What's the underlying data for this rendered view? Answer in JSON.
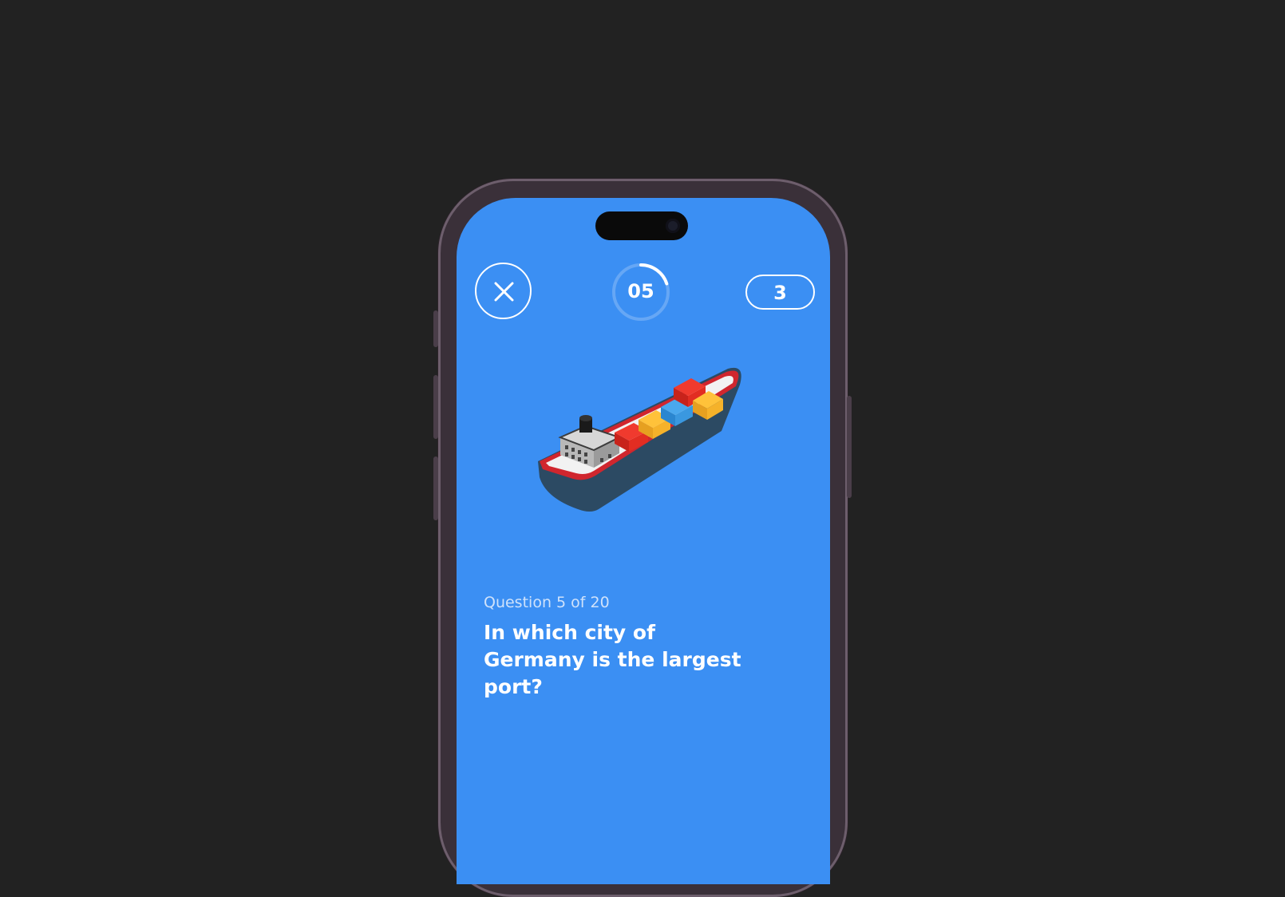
{
  "header": {
    "close_icon": "close-icon",
    "timer_value": "05",
    "timer_fraction": 0.2,
    "score": "3"
  },
  "illustration": {
    "icon": "cargo-ship-icon"
  },
  "question": {
    "counter": "Question 5 of 20",
    "text": "In which city of Germany is the largest port?"
  },
  "colors": {
    "screen_bg": "#3b8ff3",
    "page_bg": "#222222",
    "text": "#ffffff"
  }
}
